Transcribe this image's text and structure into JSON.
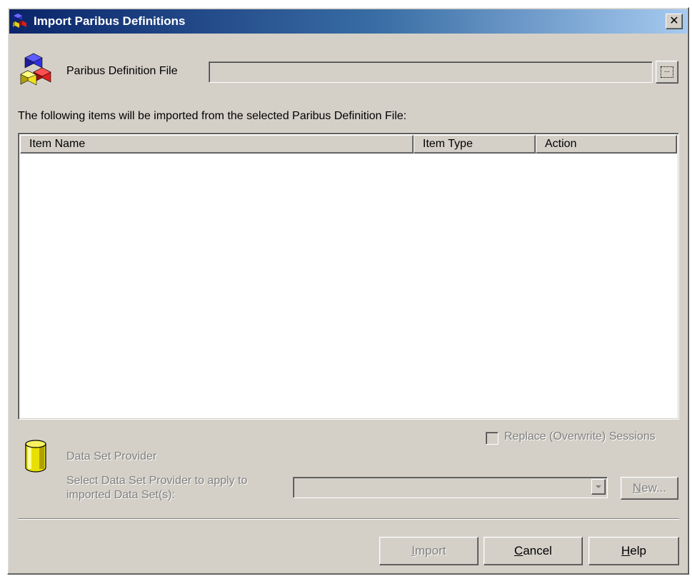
{
  "window": {
    "title": "Import Paribus Definitions",
    "close_glyph": "✕"
  },
  "definition_file": {
    "label": "Paribus Definition File",
    "value": "",
    "browse_label": "..."
  },
  "items_caption": "The following items will be imported from the selected Paribus Definition File:",
  "items_table": {
    "columns": [
      "Item Name",
      "Item Type",
      "Action"
    ],
    "rows": []
  },
  "replace_sessions": {
    "label": "Replace (Overwrite) Sessions",
    "checked": false
  },
  "data_set_provider": {
    "title": "Data Set Provider",
    "select_label_line1": "Select Data Set Provider to apply to",
    "select_label_line2": "imported Data Set(s):",
    "selected_value": "",
    "new_button": {
      "mnemonic": "N",
      "rest": "ew..."
    }
  },
  "buttons": {
    "import": {
      "mnemonic": "I",
      "rest": "mport"
    },
    "cancel": {
      "mnemonic": "C",
      "rest": "ancel"
    },
    "help": {
      "mnemonic": "H",
      "rest": "elp"
    }
  },
  "icons": {
    "title": "cubes-icon",
    "definition_file": "cubes-icon",
    "data_set_provider": "database-cylinder-icon"
  }
}
